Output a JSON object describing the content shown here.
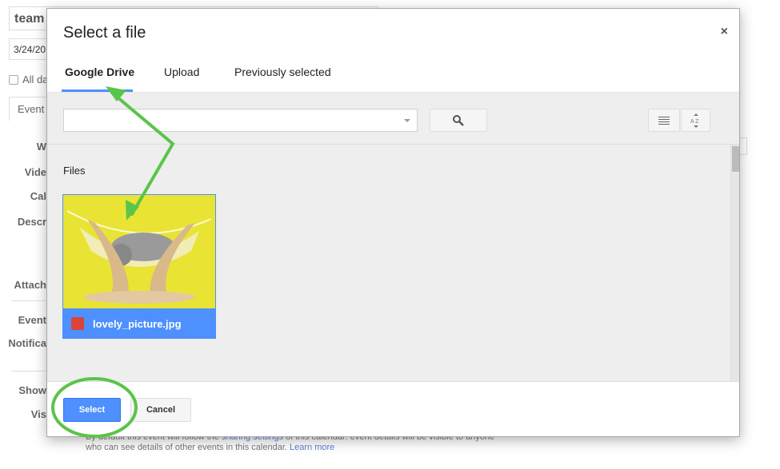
{
  "background": {
    "title_value": "team",
    "date_value": "3/24/20",
    "all_day_label": "All da",
    "event_tab": "Event",
    "labels": [
      "W",
      "Vide",
      "Cal",
      "Descr",
      "Attach",
      "Event",
      "Notifica",
      "Show",
      "Vis"
    ],
    "footer_line1_pre": "By default this event will follow the ",
    "footer_link1": "sharing settings",
    "footer_line1_post": " of this calendar: event details will be visible to anyone",
    "footer_line2": "who can see details of other events in this calendar. ",
    "footer_link2": "Learn more"
  },
  "dialog": {
    "title": "Select a file",
    "close_icon": "×",
    "tabs": [
      {
        "label": "Google Drive",
        "active": true
      },
      {
        "label": "Upload"
      },
      {
        "label": "Previously selected"
      }
    ],
    "search": {
      "value": "",
      "placeholder": ""
    },
    "section_label": "Files",
    "files": [
      {
        "name": "lovely_picture.jpg",
        "icon": "image-icon",
        "selected": true
      }
    ],
    "select_label": "Select",
    "cancel_label": "Cancel"
  },
  "annotations": {
    "color": "#5bc44a"
  },
  "colors": {
    "accent": "#4d90fe"
  }
}
